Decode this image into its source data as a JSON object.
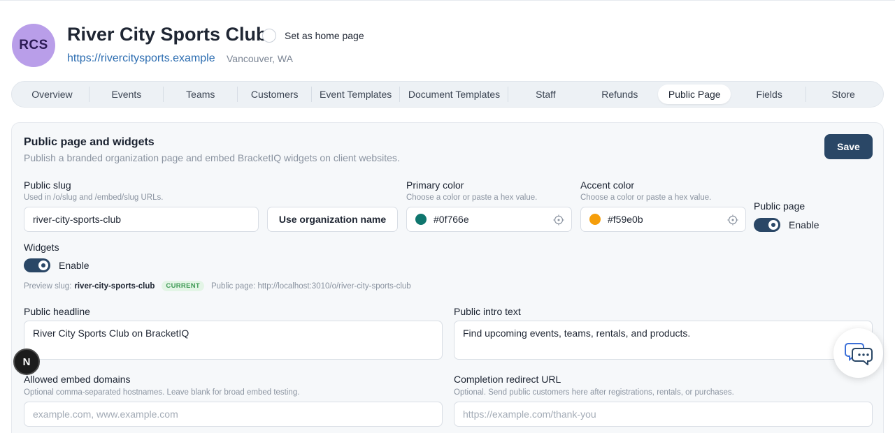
{
  "header": {
    "avatar_initials": "RCS",
    "org_name": "River City Sports Club",
    "home_page_label": "Set as home page",
    "home_page_checked": false,
    "org_url": "https://rivercitysports.example",
    "location": "Vancouver, WA"
  },
  "tabs": [
    {
      "label": "Overview",
      "active": false
    },
    {
      "label": "Events",
      "active": false
    },
    {
      "label": "Teams",
      "active": false
    },
    {
      "label": "Customers",
      "active": false
    },
    {
      "label": "Event Templates",
      "active": false
    },
    {
      "label": "Document Templates",
      "active": false
    },
    {
      "label": "Staff",
      "active": false
    },
    {
      "label": "Refunds",
      "active": false
    },
    {
      "label": "Public Page",
      "active": true
    },
    {
      "label": "Fields",
      "active": false
    },
    {
      "label": "Store",
      "active": false
    }
  ],
  "card": {
    "title": "Public page and widgets",
    "subtitle": "Publish a branded organization page and embed BracketIQ widgets on client websites.",
    "save_label": "Save"
  },
  "slug": {
    "label": "Public slug",
    "hint": "Used in /o/slug and /embed/slug URLs.",
    "value": "river-city-sports-club",
    "use_org_name_label": "Use organization name"
  },
  "primary_color": {
    "label": "Primary color",
    "hint": "Choose a color or paste a hex value.",
    "value": "#0f766e",
    "swatch": "#0f766e"
  },
  "accent_color": {
    "label": "Accent color",
    "hint": "Choose a color or paste a hex value.",
    "value": "#f59e0b",
    "swatch": "#f59e0b"
  },
  "public_page": {
    "label": "Public page",
    "toggle_label": "Enable",
    "enabled": true
  },
  "widgets": {
    "label": "Widgets",
    "toggle_label": "Enable",
    "enabled": true
  },
  "preview": {
    "slug_prefix": "Preview slug:",
    "slug_value": "river-city-sports-club",
    "badge": "CURRENT",
    "public_page_text": "Public page: http://localhost:3010/o/river-city-sports-club"
  },
  "headline": {
    "label": "Public headline",
    "value": "River City Sports Club on BracketIQ"
  },
  "intro": {
    "label": "Public intro text",
    "value": "Find upcoming events, teams, rentals, and products."
  },
  "embed_domains": {
    "label": "Allowed embed domains",
    "hint": "Optional comma-separated hostnames. Leave blank for broad embed testing.",
    "placeholder": "example.com, www.example.com"
  },
  "redirect": {
    "label": "Completion redirect URL",
    "hint": "Optional. Send public customers here after registrations, rentals, or purchases.",
    "placeholder": "https://example.com/thank-you"
  },
  "floating": {
    "dev_badge_letter": "N",
    "chat_icon": "chat-bubbles-icon"
  },
  "colors": {
    "accent_dark": "#2a4766",
    "avatar_bg": "#b99ee9",
    "link": "#2b6cb0"
  }
}
